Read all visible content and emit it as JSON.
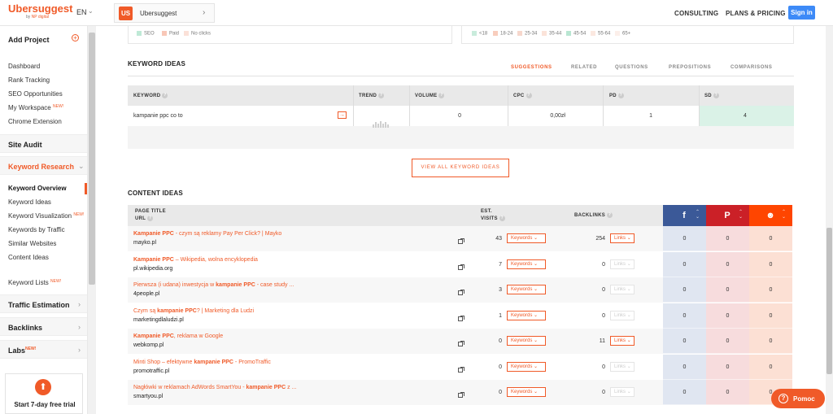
{
  "topbar": {
    "logo": "Ubersuggest",
    "logo_sub_prefix": "by",
    "logo_sub_brand": "NP digital",
    "language": "EN",
    "project_badge": "US",
    "project_name": "Ubersuggest",
    "nav": [
      "CONSULTING",
      "PLANS & PRICING"
    ],
    "signin": "Sign in"
  },
  "sidebar": {
    "add_project": "Add Project",
    "items_top": [
      "Dashboard",
      "Rank Tracking",
      "SEO Opportunities",
      "My Workspace",
      "Chrome Extension"
    ],
    "new_label": "NEW!",
    "site_audit": "Site Audit",
    "keyword_research": "Keyword Research",
    "kr_items": [
      "Keyword Overview",
      "Keyword Ideas",
      "Keyword Visualization",
      "Keywords by Traffic",
      "Similar Websites",
      "Content Ideas"
    ],
    "keyword_lists": "Keyword Lists",
    "traffic_estimation": "Traffic Estimation",
    "backlinks": "Backlinks",
    "labs": "Labs",
    "trial": "Start 7-day free trial",
    "icons": {
      "plus": "plus-circle-icon",
      "chevron": "chevron-icon",
      "trial": "arrow-up-icon"
    }
  },
  "legend_left": [
    "SEO",
    "Paid",
    "No clicks"
  ],
  "legend_right": [
    "<18",
    "18-24",
    "25-34",
    "35-44",
    "45-54",
    "55-64",
    "65+"
  ],
  "keyword_ideas": {
    "title": "KEYWORD IDEAS",
    "tabs": [
      "SUGGESTIONS",
      "RELATED",
      "QUESTIONS",
      "PREPOSITIONS",
      "COMPARISONS"
    ],
    "headers": [
      "KEYWORD",
      "TREND",
      "VOLUME",
      "CPC",
      "PD",
      "SD"
    ],
    "row": {
      "keyword": "kampanie ppc co to",
      "volume": "0",
      "cpc": "0,00zł",
      "pd": "1",
      "sd": "4"
    },
    "view_all": "VIEW ALL KEYWORD IDEAS"
  },
  "content_ideas": {
    "title": "CONTENT IDEAS",
    "headers": {
      "page_title": "PAGE TITLE",
      "url": "URL",
      "est": "EST.",
      "visits": "VISITS",
      "backlinks": "BACKLINKS"
    },
    "dropdown_keywords": "Keywords",
    "dropdown_links": "Links",
    "social_icons": [
      "facebook-icon",
      "pinterest-icon",
      "reddit-icon"
    ],
    "rows": [
      {
        "t_bold": "Kampanie PPC",
        "t_rest": " - czym są reklamy Pay Per Click? | Mayko",
        "url": "mayko.pl",
        "visits": "43",
        "backlinks": "254",
        "links_active": true,
        "fb": "0",
        "pin": "0",
        "red": "0"
      },
      {
        "t_bold": "Kampanie PPC",
        "t_rest": " – Wikipedia, wolna encyklopedia",
        "url": "pl.wikipedia.org",
        "visits": "7",
        "backlinks": "0",
        "links_active": false,
        "fb": "0",
        "pin": "0",
        "red": "0"
      },
      {
        "t_pre": "Pierwsza (i udana) inwestycja w ",
        "t_bold": "kampanie PPC",
        "t_rest": " - case study ...",
        "url": "4people.pl",
        "visits": "3",
        "backlinks": "0",
        "links_active": false,
        "fb": "0",
        "pin": "0",
        "red": "0"
      },
      {
        "t_pre": "Czym są ",
        "t_bold": "kampanie PPC",
        "t_rest": "? | Marketing dla Ludzi",
        "url": "marketingdlaludzi.pl",
        "visits": "1",
        "backlinks": "0",
        "links_active": false,
        "fb": "0",
        "pin": "0",
        "red": "0"
      },
      {
        "t_bold": "Kampanie PPC",
        "t_rest": ", reklama w Google",
        "url": "webkomp.pl",
        "visits": "0",
        "backlinks": "11",
        "links_active": true,
        "fb": "0",
        "pin": "0",
        "red": "0"
      },
      {
        "t_pre": "Minti Shop – efektywne ",
        "t_bold": "kampanie PPC",
        "t_rest": " - PromoTraffic",
        "url": "promotraffic.pl",
        "visits": "0",
        "backlinks": "0",
        "links_active": false,
        "fb": "0",
        "pin": "0",
        "red": "0"
      },
      {
        "t_pre": "Nagłówki w reklamach AdWords SmartYou - ",
        "t_bold": "kampanie PPC",
        "t_rest": " z ...",
        "url": "smartyou.pl",
        "visits": "0",
        "backlinks": "0",
        "links_active": false,
        "fb": "0",
        "pin": "0",
        "red": "0"
      }
    ]
  },
  "help_button": "Pomoc",
  "colors": {
    "accent": "#f05a28",
    "facebook": "#3b5998",
    "pinterest": "#cb2027",
    "reddit": "#ff4500"
  }
}
